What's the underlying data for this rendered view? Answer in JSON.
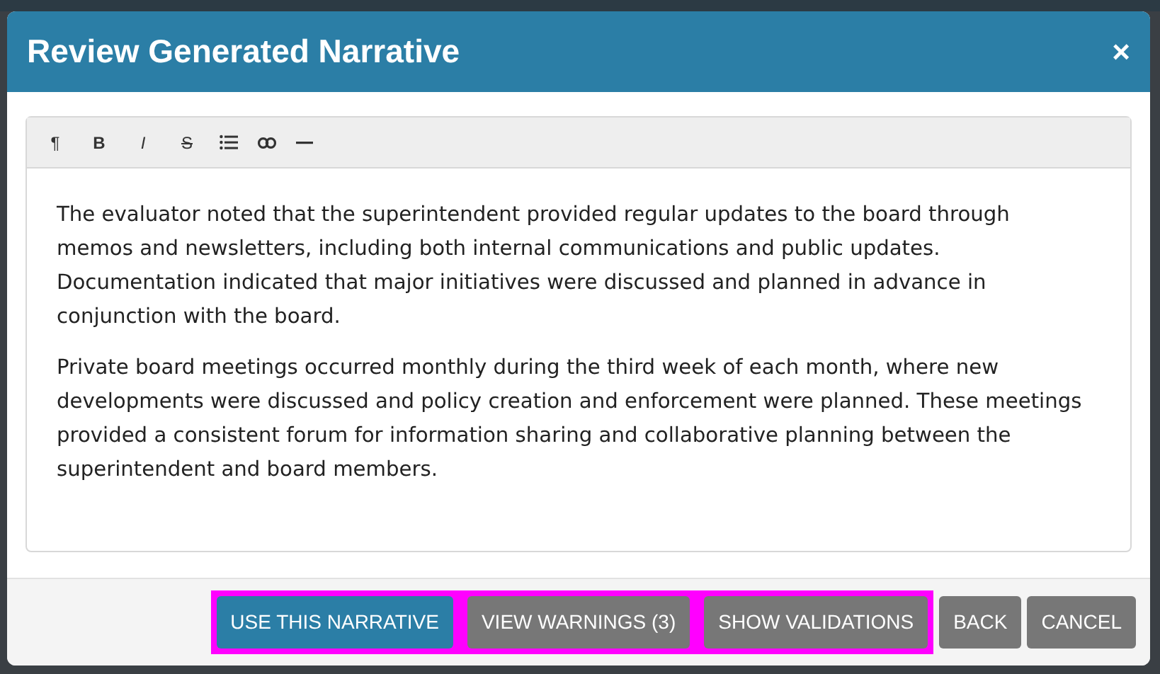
{
  "dialog": {
    "title": "Review Generated Narrative",
    "close_label": "×"
  },
  "toolbar": [
    {
      "label": "¶",
      "kind": "paragraph"
    },
    {
      "label": "B",
      "kind": "bold"
    },
    {
      "label": "I",
      "kind": "italic"
    },
    {
      "label": "S",
      "kind": "strike"
    },
    {
      "kind": "list"
    },
    {
      "kind": "link"
    },
    {
      "kind": "rule"
    }
  ],
  "paragraphs": [
    "The evaluator noted that the superintendent provided regular updates to the board through memos and newsletters, including both internal communications and public updates. Documentation indicated that major initiatives were discussed and planned in advance in conjunction with the board.",
    "Private board meetings occurred monthly during the third week of each month, where new developments were discussed and policy creation and enforcement were planned. These meetings provided a consistent forum for information sharing and collaborative planning between the superintendent and board members."
  ],
  "buttons": [
    {
      "label": "USE THIS NARRATIVE",
      "kind": "primary",
      "highlighted": true
    },
    {
      "label": "VIEW WARNINGS (3)",
      "kind": "secondary",
      "highlighted": true
    },
    {
      "label": "SHOW VALIDATIONS",
      "kind": "secondary",
      "highlighted": true
    },
    {
      "label": "BACK",
      "kind": "secondary",
      "highlighted": false
    },
    {
      "label": "CANCEL",
      "kind": "secondary",
      "highlighted": false
    }
  ]
}
